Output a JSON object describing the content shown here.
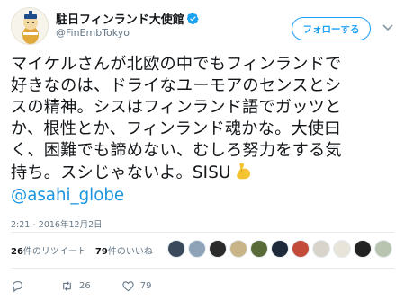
{
  "account": {
    "display_name": "駐日フィンランド大使館",
    "handle": "@FinEmbTokyo"
  },
  "follow_button": {
    "label": "フォローする"
  },
  "tweet": {
    "lines": [
      "マイケルさんが北欧の中でもフィンランドで",
      "好きなのは、ドライなユーモアのセンスとシ",
      "スの精神。シスはフィンランド語でガッツと",
      "か、根性とか、フィンランド魂かな。大使曰",
      "く、困難でも諦めない、むしろ努力をする気",
      "持ち。スシじゃないよ。SISU"
    ],
    "emoji": "flexed-biceps",
    "mention": "@asahi_globe",
    "timestamp": "2:21 - 2016年12月2日"
  },
  "stats": {
    "retweet_count": "26",
    "retweet_label": "件のリツイート",
    "like_count": "79",
    "like_label": "件のいいね"
  },
  "likers": [
    {
      "color": "#3a4a5c"
    },
    {
      "color": "#8fa3b8"
    },
    {
      "color": "#2b2b2b"
    },
    {
      "color": "#c9b48a"
    },
    {
      "color": "#5a6b3a"
    },
    {
      "color": "#1e2a3a"
    },
    {
      "color": "#c24b3a"
    },
    {
      "color": "#d8d4cc"
    },
    {
      "color": "#e8e4da"
    },
    {
      "color": "#222222"
    },
    {
      "color": "#b8c4b0"
    }
  ],
  "actions": {
    "reply_count": "",
    "retweet_count": "26",
    "like_count": "79"
  },
  "colors": {
    "accent": "#1da1f2",
    "link": "#1b95e0",
    "secondary_text": "#657786"
  }
}
